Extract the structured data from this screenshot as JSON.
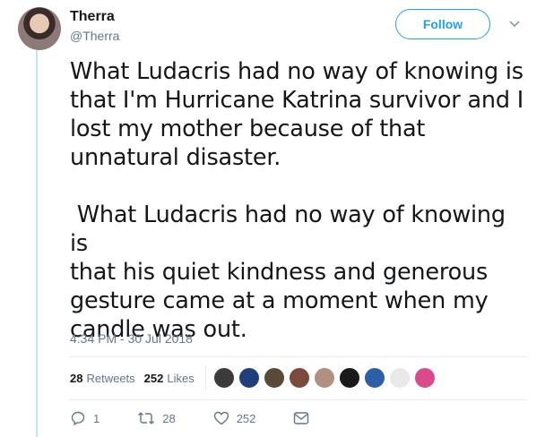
{
  "author": {
    "name": "Therra",
    "handle": "@Therra"
  },
  "follow_label": "Follow",
  "tweet": {
    "text": "What Ludacris had no way of knowing is\nthat I'm Hurricane Katrina survivor and I\nlost my mother because of that\nunnatural disaster.\n\n What Ludacris had no way of knowing is\nthat his quiet kindness and generous\ngesture came at a moment when my\ncandle was out."
  },
  "timestamp": "4:34 PM - 30 Jul 2018",
  "stats": {
    "retweets_count": "28",
    "retweets_label": "Retweets",
    "likes_count": "252",
    "likes_label": "Likes"
  },
  "likers": [
    {
      "name": "liker-avatar-1",
      "color": "#3b3b3b"
    },
    {
      "name": "liker-avatar-2",
      "color": "#1f3f7a"
    },
    {
      "name": "liker-avatar-3",
      "color": "#5a4a3a"
    },
    {
      "name": "liker-avatar-4",
      "color": "#7c4a3a"
    },
    {
      "name": "liker-avatar-5",
      "color": "#b09080"
    },
    {
      "name": "liker-avatar-6",
      "color": "#1a1a1a"
    },
    {
      "name": "liker-avatar-7",
      "color": "#2d5fa8"
    },
    {
      "name": "liker-avatar-8",
      "color": "#e9e9e9"
    },
    {
      "name": "liker-avatar-9",
      "color": "#d94a8c"
    }
  ],
  "actions": {
    "reply_count": "1",
    "retweet_count": "28",
    "like_count": "252"
  },
  "colors": {
    "accent": "#1da1f2",
    "secondary_text": "#657786",
    "thread_line": "#c4e3f3"
  }
}
